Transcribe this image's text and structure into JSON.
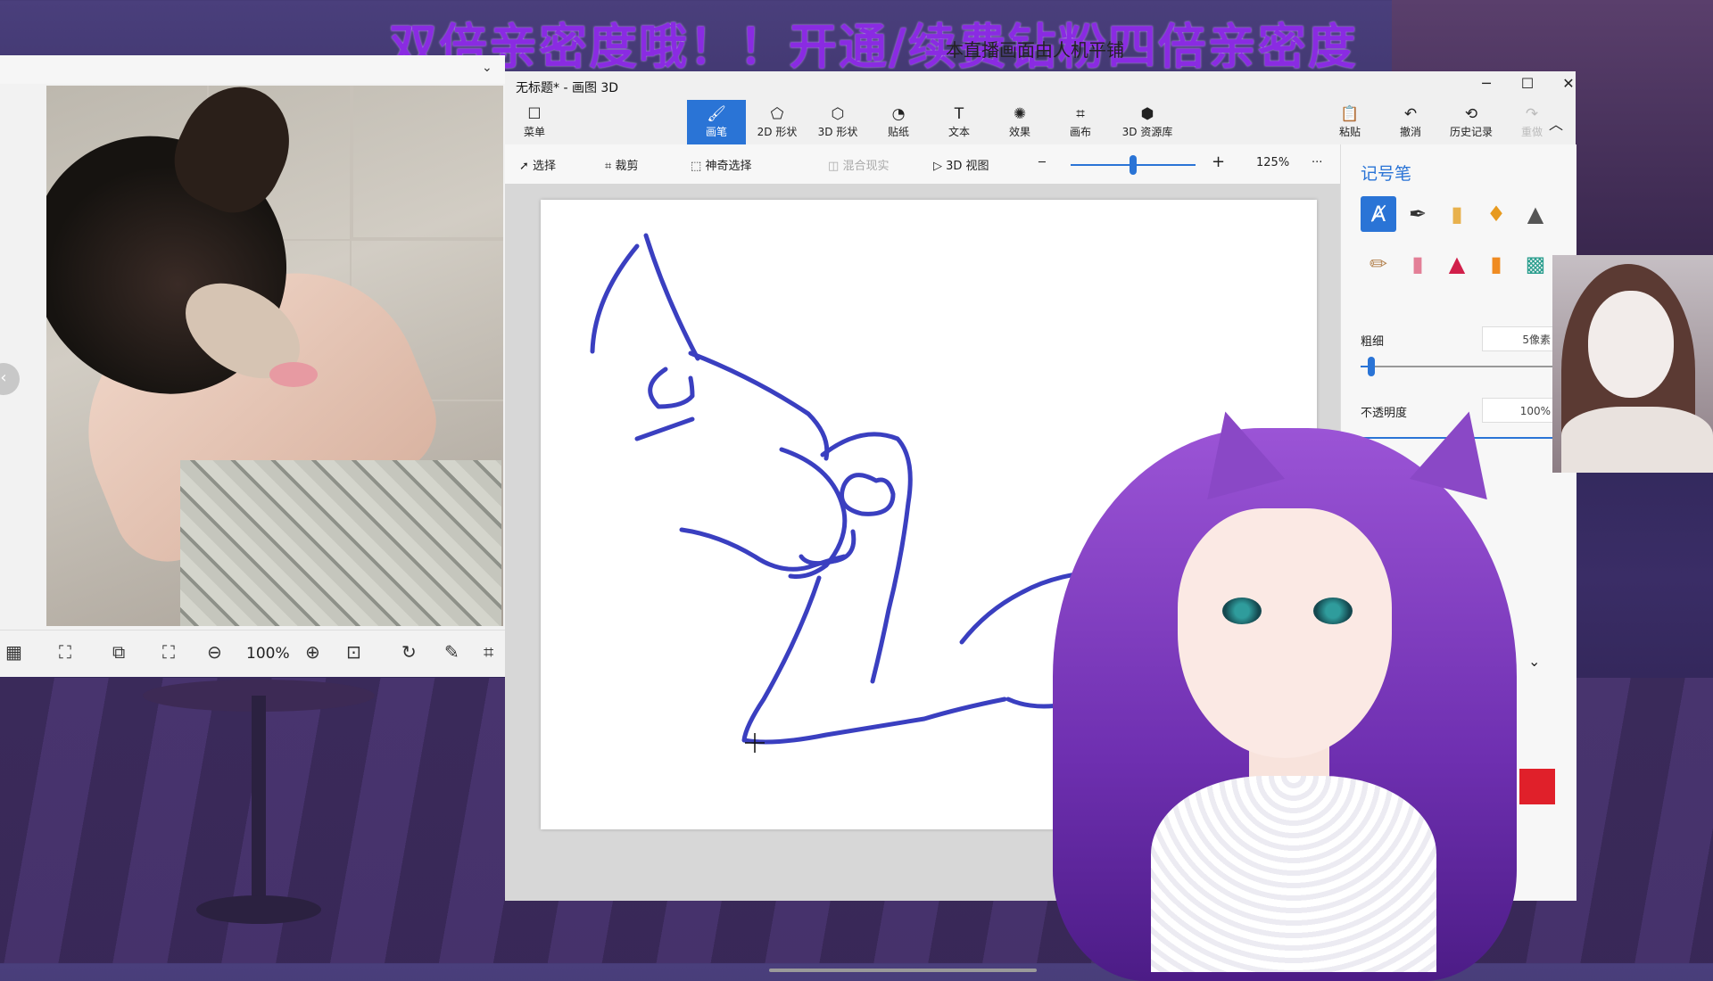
{
  "banner": {
    "text": "双倍亲密度哦！！开通/续费钻粉四倍亲密度",
    "subtext": "本直播画面由人机平铺"
  },
  "viewer": {
    "chevron": "⌄",
    "nav_left": "‹",
    "zoom": "100%"
  },
  "paint": {
    "title": "无标题* - 画图 3D",
    "window": {
      "min": "─",
      "max": "☐",
      "close": "✕"
    },
    "ribbon": [
      {
        "key": "menu",
        "label": "菜单",
        "icon": "☐"
      },
      {
        "key": "brushes",
        "label": "画笔",
        "icon": "🖌"
      },
      {
        "key": "2d",
        "label": "2D 形状",
        "icon": "⬠"
      },
      {
        "key": "3d",
        "label": "3D 形状",
        "icon": "⬡"
      },
      {
        "key": "sticker",
        "label": "贴纸",
        "icon": "◔"
      },
      {
        "key": "text",
        "label": "文本",
        "icon": "T"
      },
      {
        "key": "effects",
        "label": "效果",
        "icon": "✺"
      },
      {
        "key": "canvas",
        "label": "画布",
        "icon": "⌗"
      },
      {
        "key": "lib",
        "label": "3D 资源库",
        "icon": "⬢"
      },
      {
        "key": "paste",
        "label": "粘贴",
        "icon": "📋"
      },
      {
        "key": "undo",
        "label": "撤消",
        "icon": "↶"
      },
      {
        "key": "history",
        "label": "历史记录",
        "icon": "⟲"
      },
      {
        "key": "redo",
        "label": "重做",
        "icon": "↷"
      }
    ],
    "toolbar": {
      "select": "选择",
      "crop": "裁剪",
      "magic_select": "神奇选择",
      "mixed_reality": "混合现实",
      "view3d": "3D 视图",
      "zoom": "125%",
      "more": "···",
      "minus": "─",
      "plus": "+"
    },
    "panel": {
      "title": "记号笔",
      "thickness_label": "粗细",
      "thickness_value": "5像素",
      "thickness_level": 0.05,
      "opacity_label": "不透明度",
      "opacity_value": "100%",
      "opacity_level": 1.0
    },
    "stroke_color": "#3a3fc0"
  }
}
